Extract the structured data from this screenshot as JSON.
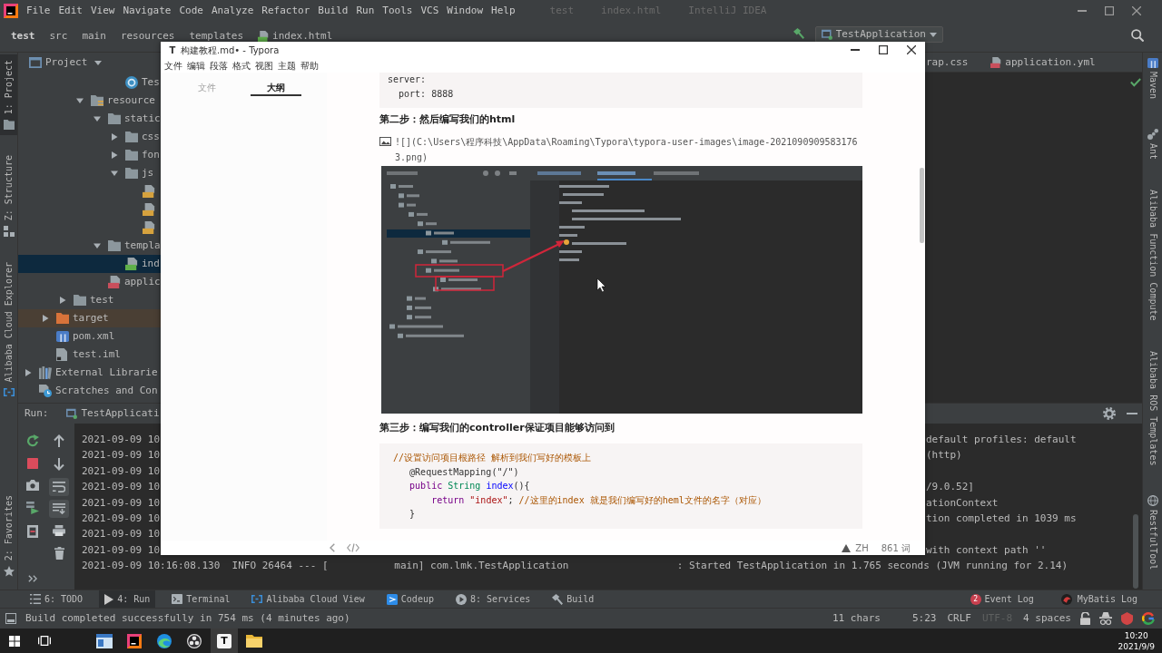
{
  "ide": {
    "menu": [
      "File",
      "Edit",
      "View",
      "Navigate",
      "Code",
      "Analyze",
      "Refactor",
      "Build",
      "Run",
      "Tools",
      "VCS",
      "Window",
      "Help"
    ],
    "title": [
      "test",
      "index.html",
      "IntelliJ IDEA"
    ],
    "breadcrumbs": [
      {
        "label": "test",
        "kind": "project"
      },
      {
        "label": "src",
        "kind": "dir"
      },
      {
        "label": "main",
        "kind": "dir"
      },
      {
        "label": "resources",
        "kind": "dir"
      },
      {
        "label": "templates",
        "kind": "dir"
      },
      {
        "label": "index.html",
        "kind": "html"
      }
    ],
    "run_config": "TestApplication",
    "left_tools": [
      {
        "label": "1: Project",
        "kind": "project",
        "selected": true
      },
      {
        "label": "Z: Structure",
        "kind": "structure",
        "selected": false
      },
      {
        "label": "Alibaba Cloud Explorer",
        "kind": "cloud",
        "selected": false
      },
      {
        "label": "2: Favorites",
        "kind": "favorites",
        "selected": false
      }
    ],
    "project": {
      "title": "Project",
      "tree": [
        {
          "children": [
            {
              "children": [
                {
                  "children": [
                    {
                      "children": [
                        {
                          "children": [
                            {
                              "label": "Tes",
                              "kind": "class",
                              "selected": false
                            }
                          ]
                        }
                      ]
                    },
                    {
                      "label": "resource",
                      "kind": "resources",
                      "expanded": true,
                      "selected": false,
                      "children": [
                        {
                          "label": "static",
                          "kind": "folder",
                          "expanded": true,
                          "selected": false,
                          "children": [
                            {
                              "label": "css",
                              "kind": "folder",
                              "expanded": false,
                              "selected": false
                            },
                            {
                              "label": "fon",
                              "kind": "folder",
                              "expanded": false,
                              "selected": false
                            },
                            {
                              "label": "js",
                              "kind": "folder",
                              "expanded": true,
                              "selected": false,
                              "children": [
                                {
                                  "kind": "js",
                                  "selected": false
                                },
                                {
                                  "kind": "js",
                                  "selected": false
                                },
                                {
                                  "kind": "js",
                                  "selected": false
                                }
                              ]
                            }
                          ]
                        },
                        {
                          "label": "templa",
                          "kind": "folder",
                          "expanded": true,
                          "selected": false,
                          "children": [
                            {
                              "label": "ind",
                              "kind": "html",
                              "selected": true
                            }
                          ]
                        },
                        {
                          "label": "applic",
                          "kind": "yml",
                          "selected": false
                        }
                      ]
                    }
                  ]
                },
                {
                  "label": "test",
                  "kind": "folder",
                  "expanded": false,
                  "selected": false
                }
              ]
            },
            {
              "label": "target",
              "kind": "excluded",
              "expanded": false,
              "selected": false
            },
            {
              "label": "pom.xml",
              "kind": "maven",
              "selected": false
            },
            {
              "label": "test.iml",
              "kind": "iml",
              "selected": false
            }
          ]
        },
        {
          "label": "External Librarie",
          "kind": "libraries",
          "expanded": false,
          "selected": false
        },
        {
          "label": "Scratches and Con",
          "kind": "scratches",
          "selected": false
        }
      ]
    },
    "editor_tabs": [
      {
        "label": "rap.css",
        "kind": "plain"
      },
      {
        "label": "application.yml",
        "kind": "yml"
      }
    ],
    "right_tools": [
      {
        "label": "Maven",
        "kind": "maven"
      },
      {
        "label": "Ant",
        "kind": "ant"
      },
      {
        "label": "Alibaba Function Compute",
        "kind": "plain"
      },
      {
        "label": "Alibaba ROS Templates",
        "kind": "plain"
      },
      {
        "label": "RestfulTool",
        "kind": "globe"
      }
    ],
    "run": {
      "label": "Run:",
      "tab": "TestApplicati",
      "actions": [
        {
          "kind": "rerun"
        },
        {
          "kind": "stop"
        },
        {
          "kind": "camera"
        },
        {
          "kind": "arrow"
        },
        {
          "kind": "exit"
        }
      ],
      "toggles": [
        {
          "kind": "up",
          "on": false
        },
        {
          "kind": "down",
          "on": false
        },
        {
          "kind": "wrap",
          "on": true
        },
        {
          "kind": "scroll",
          "on": true
        },
        {
          "kind": "print",
          "on": false
        },
        {
          "kind": "trash",
          "on": false
        }
      ],
      "log": [
        {
          "start": "2021-09-09 10",
          "end": "default profiles: default"
        },
        {
          "start": "2021-09-09 10",
          "end": "(http)"
        },
        {
          "start": "2021-09-09 10"
        },
        {
          "start": "2021-09-09 10",
          "end": "/9.0.52]"
        },
        {
          "start": "2021-09-09 10",
          "end": "ationContext"
        },
        {
          "start": "2021-09-09 10",
          "end": "tion completed in 1039 ms"
        },
        {
          "start": "2021-09-09 10"
        },
        {
          "start": "2021-09-09 10",
          "end": "with context path ''"
        },
        {
          "start": "2021-09-09 10:16:08.130  INFO 26464 --- [           main] com.lmk.TestApplication                  : Started TestApplication in 1.765 seconds (JVM running for 2.14)"
        }
      ]
    },
    "tool_tabs": [
      {
        "label": "6: TODO",
        "kind": "todo",
        "selected": false
      },
      {
        "label": "4: Run",
        "kind": "run",
        "selected": true
      },
      {
        "label": "Terminal",
        "kind": "terminal",
        "selected": false
      },
      {
        "label": "Alibaba Cloud View",
        "kind": "cloud",
        "selected": false
      },
      {
        "label": "Codeup",
        "kind": "codeup",
        "selected": false
      },
      {
        "label": "8: Services",
        "kind": "services",
        "selected": false
      },
      {
        "label": "Build",
        "kind": "build",
        "selected": false
      }
    ],
    "event_log": {
      "label": "Event Log",
      "count": "2"
    },
    "mybatis_log": "MyBatis Log",
    "status": {
      "message": "Build completed successfully in 754 ms (4 minutes ago)",
      "items": [
        {
          "text": "11 chars",
          "disabled": false
        },
        {
          "text": "5:23",
          "disabled": false
        },
        {
          "text": "CRLF",
          "disabled": false
        },
        {
          "text": "UTF-8",
          "disabled": true
        },
        {
          "text": "4 spaces",
          "disabled": false
        }
      ]
    }
  },
  "typora": {
    "icon": "T",
    "title": "构建教程.md• - Typora",
    "menu": [
      "文件",
      "编辑",
      "段落",
      "格式",
      "视图",
      "主题",
      "帮助"
    ],
    "sidebar_tabs": [
      {
        "label": "文件",
        "selected": false
      },
      {
        "label": "大纲",
        "selected": true
      }
    ],
    "content": [
      {
        "kind": "code",
        "lines": [
          [
            {
              "text": "server:",
              "kind": "plain"
            }
          ],
          [
            {
              "text": "  port: 8888",
              "kind": "plain"
            }
          ]
        ]
      },
      {
        "kind": "heading",
        "text": "第二步：然后编写我们的html"
      },
      {
        "kind": "image_link",
        "text": "![](C:\\Users\\程序科技\\AppData\\Roaming\\Typora\\typora-user-images\\image-20210909095831763.png)"
      },
      {
        "kind": "image"
      },
      {
        "kind": "heading",
        "text": "第三步：编写我们的controller保证项目能够访问到"
      },
      {
        "kind": "code",
        "lines": [
          [
            {
              "text": " //设置访问项目根路径 解析到我们写好的模板上",
              "kind": "comment"
            }
          ],
          [
            {
              "text": "    @RequestMapping(\"/\")",
              "kind": "plain"
            }
          ],
          [
            {
              "text": "    public",
              "kind": "keyword"
            },
            {
              "text": " String",
              "kind": "type"
            },
            {
              "text": " index",
              "kind": "def"
            },
            {
              "text": "(){",
              "kind": "plain"
            }
          ],
          [
            {
              "text": "        return",
              "kind": "keyword"
            },
            {
              "text": " \"index\"",
              "kind": "string"
            },
            {
              "text": "; ",
              "kind": "plain"
            },
            {
              "text": "//这里的index 就是我们编写好的heml文件的名字（对应）",
              "kind": "comment"
            }
          ],
          [
            {
              "text": "    }",
              "kind": "plain"
            }
          ]
        ]
      }
    ],
    "footer": {
      "language": "ZH",
      "word_count": "861 词"
    }
  },
  "taskbar": {
    "apps": [
      {
        "kind": "window",
        "selected": false
      },
      {
        "kind": "ide",
        "selected": false
      },
      {
        "kind": "browser",
        "selected": false
      },
      {
        "kind": "recorder",
        "selected": false
      },
      {
        "kind": "letter",
        "letter": "T",
        "selected": true
      },
      {
        "kind": "folder",
        "selected": false
      }
    ],
    "time": "10:20",
    "date": "2021/9/9"
  }
}
